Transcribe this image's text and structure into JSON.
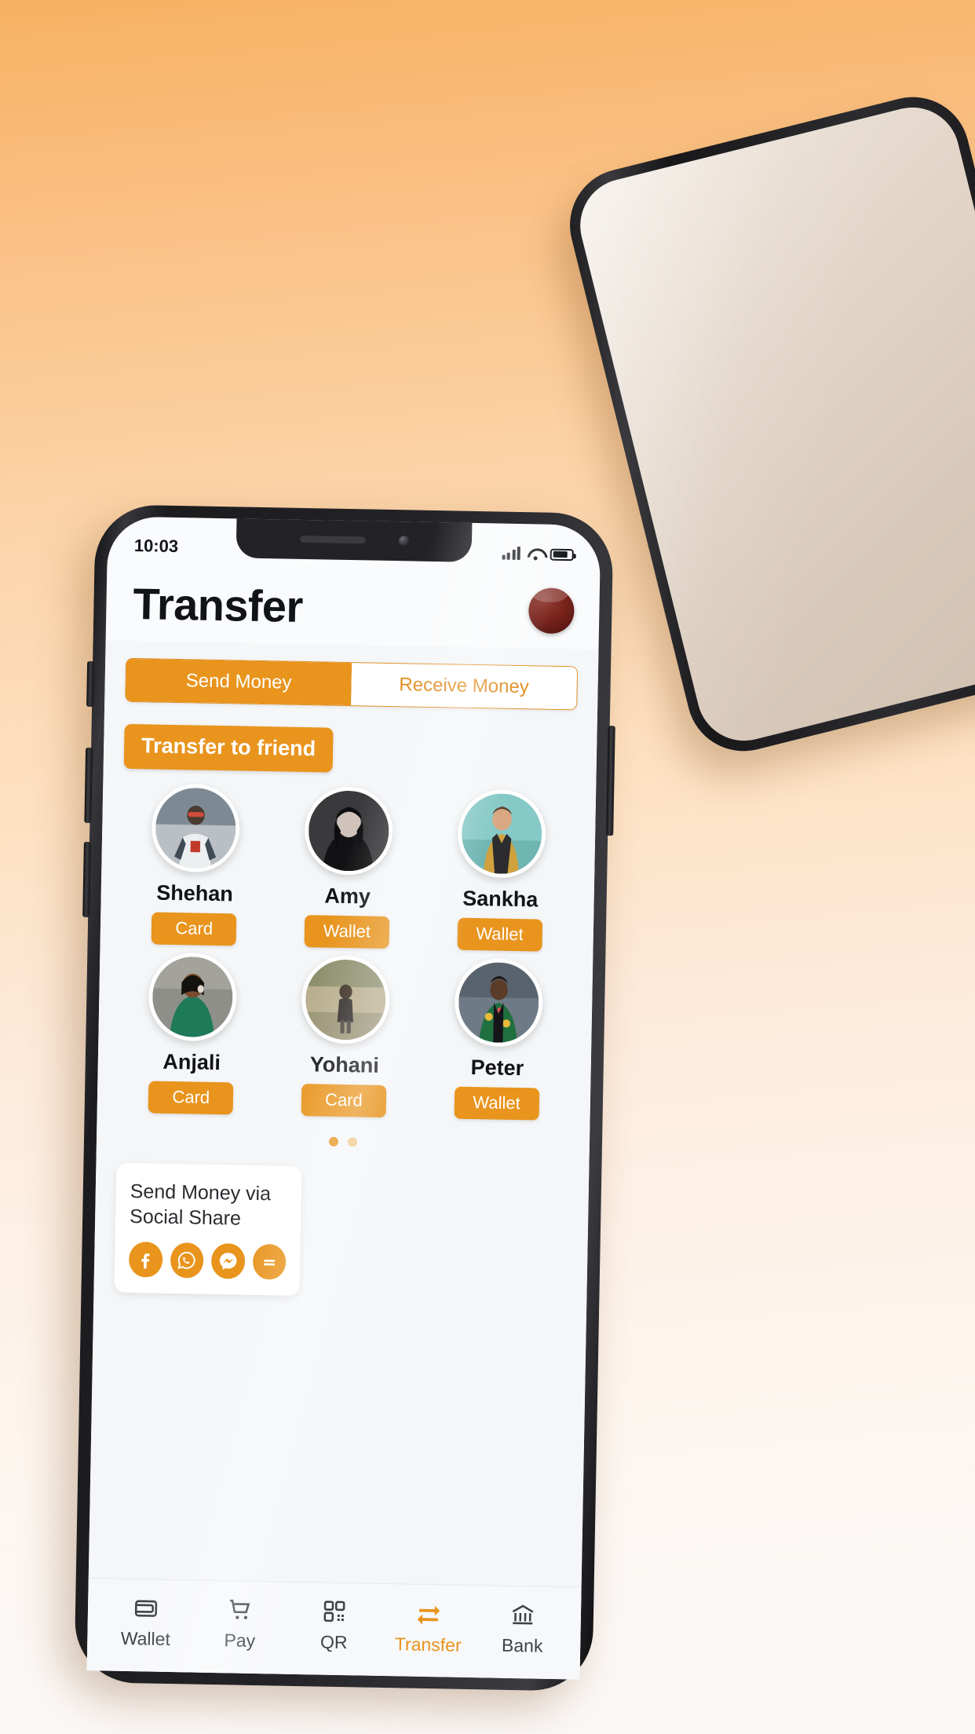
{
  "statusbar": {
    "time": "10:03",
    "signal_icon": "cellular-signal-icon",
    "wifi_icon": "wifi-icon",
    "battery_icon": "battery-icon"
  },
  "header": {
    "title": "Transfer",
    "avatar_label": "profile-avatar"
  },
  "tabs": [
    {
      "label": "Send Money",
      "active": true
    },
    {
      "label": "Receive Money",
      "active": false
    }
  ],
  "section": {
    "title": "Transfer to friend"
  },
  "contacts": [
    {
      "name": "Shehan",
      "badge": "Card"
    },
    {
      "name": "Amy",
      "badge": "Wallet"
    },
    {
      "name": "Sankha",
      "badge": "Wallet"
    },
    {
      "name": "Anjali",
      "badge": "Card"
    },
    {
      "name": "Yohani",
      "badge": "Card"
    },
    {
      "name": "Peter",
      "badge": "Wallet"
    }
  ],
  "pager": {
    "total": 2,
    "current": 1
  },
  "social": {
    "title_line1": "Send Money via",
    "title_line2": "Social Share",
    "icons": [
      {
        "name": "facebook-icon"
      },
      {
        "name": "whatsapp-icon"
      },
      {
        "name": "messenger-icon"
      },
      {
        "name": "more-share-icon"
      }
    ]
  },
  "bottom_nav": [
    {
      "label": "Wallet",
      "icon": "wallet-icon",
      "active": false
    },
    {
      "label": "Pay",
      "icon": "cart-icon",
      "active": false
    },
    {
      "label": "QR",
      "icon": "qr-code-icon",
      "active": false
    },
    {
      "label": "Transfer",
      "icon": "transfer-icon",
      "active": true
    },
    {
      "label": "Bank",
      "icon": "bank-icon",
      "active": false
    }
  ],
  "colors": {
    "accent": "#e8941d",
    "accent_border": "#e08b1e",
    "text_dark": "#111317",
    "screen_bg": "#f4f6f8"
  }
}
